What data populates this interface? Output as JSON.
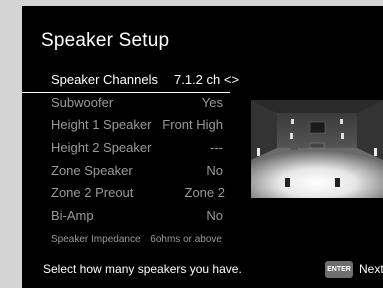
{
  "screen": {
    "title": "Speaker Setup"
  },
  "menu": [
    {
      "label": "Speaker Channels",
      "value": "7.1.2 ch <>",
      "selected": true
    },
    {
      "label": "Subwoofer",
      "value": "Yes"
    },
    {
      "label": "Height 1 Speaker",
      "value": "Front High"
    },
    {
      "label": "Height 2 Speaker",
      "value": "---"
    },
    {
      "label": "Zone Speaker",
      "value": "No"
    },
    {
      "label": "Zone 2 Preout",
      "value": "Zone 2"
    },
    {
      "label": "Bi-Amp",
      "value": "No"
    },
    {
      "label": "Speaker Impedance",
      "value": "6ohms or above"
    }
  ],
  "footer": {
    "help": "Select how many speakers you have.",
    "enter_key": "ENTER",
    "next": "Next"
  },
  "colors": {
    "background": "#000000",
    "active_text": "#ffffff",
    "inactive_text": "#9a9a9a",
    "frame": "#d4d4d4"
  }
}
